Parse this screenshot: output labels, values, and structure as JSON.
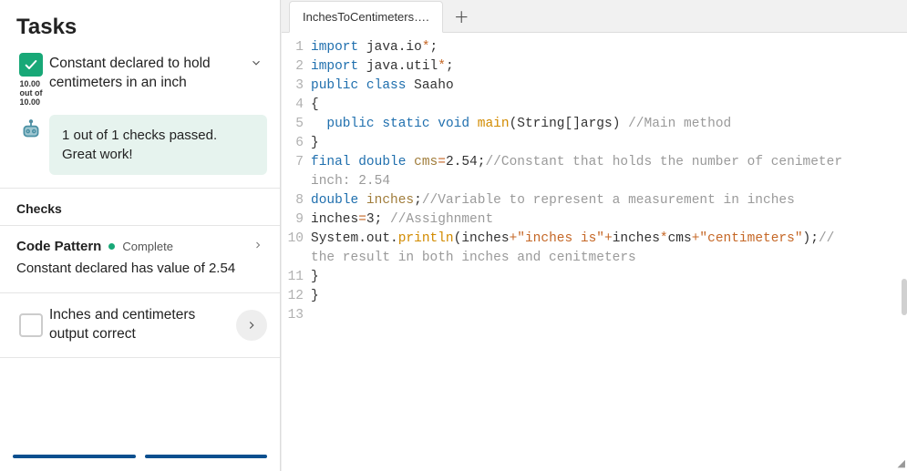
{
  "tasks_title": "Tasks",
  "task1": {
    "description": "Constant declared to hold centimeters in an inch",
    "score_value": "10.00",
    "score_mid": "out of",
    "score_total": "10.00",
    "feedback": "1 out of 1 checks passed. Great work!"
  },
  "checks_label": "Checks",
  "check1": {
    "title": "Code Pattern",
    "status": "Complete",
    "description": "Constant declared has value of 2.54"
  },
  "task2": {
    "description": "Inches and centimeters output correct"
  },
  "tab": {
    "label": "InchesToCentimeters…."
  },
  "code": {
    "l1": {
      "n": "1",
      "a": "import ",
      "b": "java.io",
      "c": "*",
      "d": ";"
    },
    "l2": {
      "n": "2",
      "a": "import ",
      "b": "java.util",
      "c": "*",
      "d": ";"
    },
    "l3": {
      "n": "3",
      "a": "public ",
      "b": "class ",
      "c": "Saaho"
    },
    "l4": {
      "n": "4",
      "a": "{"
    },
    "l5": {
      "n": "5",
      "a": "  public ",
      "b": "static ",
      "c": "void ",
      "d": "main",
      "e": "(String[]args) ",
      "f": "//Main method"
    },
    "l6": {
      "n": "6",
      "a": "}"
    },
    "l7": {
      "n": "7",
      "a": "final ",
      "b": "double ",
      "c": "cms",
      "d": "=",
      "e": "2.54",
      "f": ";",
      "g": "//Constant that holds the number of cenimeter",
      "h": "inch: 2.54"
    },
    "l8": {
      "n": "8",
      "a": "double ",
      "b": "inches",
      "c": ";",
      "d": "//Variable to represent a measurement in inches"
    },
    "l9": {
      "n": "9",
      "a": "inches",
      "b": "=",
      "c": "3",
      "d": "; ",
      "e": "//Assighnment"
    },
    "l10": {
      "n": "10",
      "a": "System.out.",
      "b": "println",
      "c": "(inches",
      "d": "+",
      "e": "\"inches is\"",
      "f": "+",
      "g": "inches",
      "h": "*",
      "i": "cms",
      "j": "+",
      "k": "\"centimeters\"",
      "l": ");",
      "m": "//",
      "wrap": "the result in both inches and cenitmeters"
    },
    "l11": {
      "n": "11",
      "a": "}"
    },
    "l12": {
      "n": "12",
      "a": "}"
    },
    "l13": {
      "n": "13",
      "a": ""
    }
  }
}
